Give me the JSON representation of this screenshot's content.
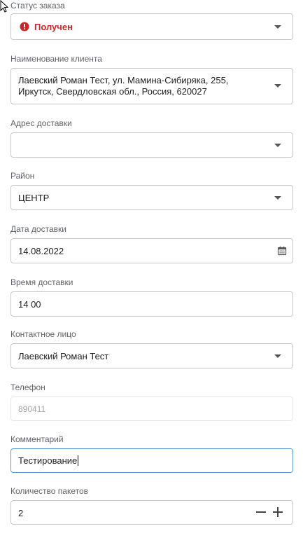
{
  "form": {
    "status": {
      "label": "Статус заказа",
      "value": "Получен",
      "icon": "alert-circle-icon",
      "color": "#c62828"
    },
    "client": {
      "label": "Наименование клиента",
      "value": "Лаевский Роман Тест, ул. Мамина-Сибиряка, 255, Иркутск, Свердловская обл., Россия, 620027"
    },
    "address": {
      "label": "Адрес доставки",
      "value": ""
    },
    "district": {
      "label": "Район",
      "value": "ЦЕНТР"
    },
    "date": {
      "label": "Дата доставки",
      "value": "14.08.2022",
      "icon": "calendar-icon"
    },
    "time": {
      "label": "Время доставки",
      "value": "14 00"
    },
    "contact": {
      "label": "Контактное лицо",
      "value": "Лаевский Роман Тест"
    },
    "phone": {
      "label": "Телефон",
      "value": "890411"
    },
    "comment": {
      "label": "Комментарий",
      "value": "Тестирование"
    },
    "packages": {
      "label": "Количество пакетов",
      "value": "2",
      "decrement_icon": "minus-icon",
      "increment_icon": "plus-icon"
    }
  }
}
